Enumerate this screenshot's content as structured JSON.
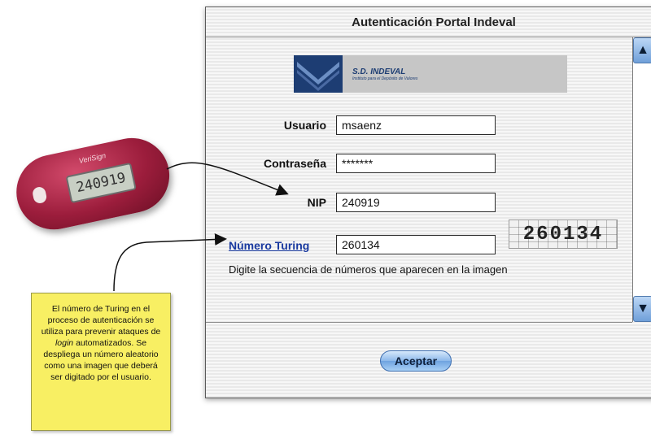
{
  "window": {
    "title": "Autenticación Portal Indeval",
    "button_accept": "Aceptar"
  },
  "logo": {
    "name": "S.D. INDEVAL",
    "subtitle": "Instituto para el Depósito de Valores"
  },
  "form": {
    "usuario_label": "Usuario",
    "usuario_value": "msaenz",
    "contrasena_label": "Contraseña",
    "contrasena_value": "*******",
    "nip_label": "NIP",
    "nip_value": "240919",
    "turing_label": "Número Turing",
    "turing_value": "260134",
    "captcha_text": "260134",
    "hint": "Digite la secuencia de números que aparecen en la imagen"
  },
  "token": {
    "brand": "VeriSign",
    "display": "240919"
  },
  "note": {
    "part1": "El número de Turing en el proceso de autenticación se utiliza para prevenir ataques de",
    "italic": "login",
    "part2": "automatizados. Se despliega un número aleatorio como una imagen que deberá ser digitado por el usuario."
  },
  "icons": {
    "scroll_up": "up-triangle",
    "scroll_down": "down-triangle"
  },
  "colors": {
    "note_bg": "#f8ef63",
    "token_red": "#9c1d3c",
    "link_blue": "#1a3aa0"
  }
}
